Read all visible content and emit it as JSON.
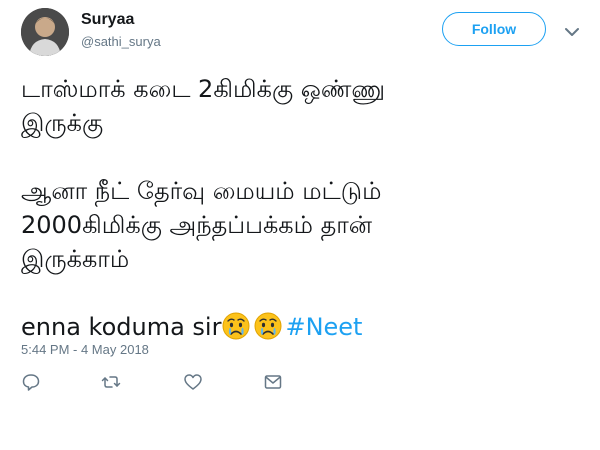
{
  "user": {
    "display_name": "Suryaa",
    "handle": "@sathi_surya",
    "avatar_icon": "avatar-photo"
  },
  "follow_button": {
    "label": "Follow",
    "color": "#1da1f2"
  },
  "tweet": {
    "line1": "டாஸ்மாக் கடை 2கிமிக்கு ஒண்ணு",
    "line2": "இருக்கு",
    "line3": "ஆனா நீட் தேர்வு மையம் மட்டும்",
    "line4": "2000கிமிக்கு அந்தப்பக்கம் தான்",
    "line5": "இருக்காம்",
    "line6_text": "enna koduma sir",
    "emojis": [
      "crying-face-emoji",
      "crying-face-emoji"
    ],
    "hashtag": "#Neet"
  },
  "timestamp": "5:44 PM - 4 May 2018",
  "actions": {
    "icons": [
      "reply-icon",
      "retweet-icon",
      "like-icon",
      "message-icon"
    ]
  },
  "colors": {
    "accent": "#1da1f2",
    "secondary_text": "#657786",
    "primary_text": "#14171a"
  }
}
